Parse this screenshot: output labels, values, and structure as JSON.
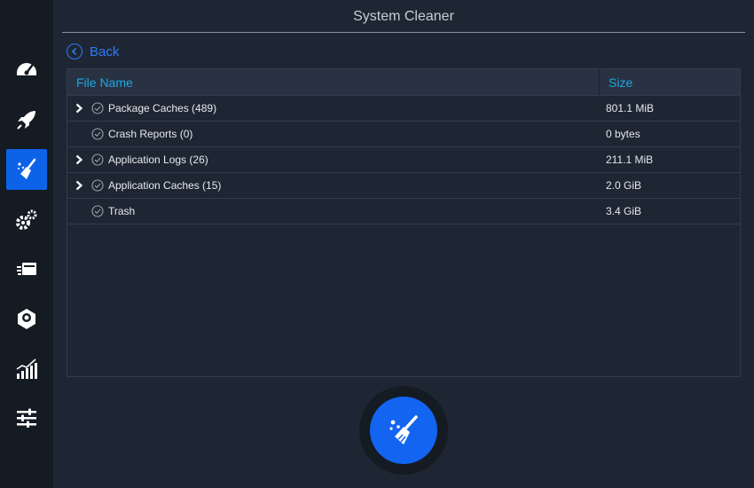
{
  "window": {
    "title": "System Cleaner"
  },
  "sidebar": {
    "items": [
      {
        "icon": "dashboard-gauge-icon"
      },
      {
        "icon": "startup-rocket-icon"
      },
      {
        "icon": "system-cleaner-broom-icon",
        "active": true
      },
      {
        "icon": "services-gears-icon"
      },
      {
        "icon": "processes-icon"
      },
      {
        "icon": "uninstaller-icon"
      },
      {
        "icon": "resources-chart-icon"
      },
      {
        "icon": "settings-sliders-icon"
      }
    ]
  },
  "back": {
    "label": "Back"
  },
  "table": {
    "columns": {
      "name": "File Name",
      "size": "Size"
    },
    "rows": [
      {
        "name": "Package Caches (489)",
        "size": "801.1 MiB",
        "expandable": true
      },
      {
        "name": "Crash Reports (0)",
        "size": "0 bytes",
        "expandable": false
      },
      {
        "name": "Application Logs (26)",
        "size": "211.1 MiB",
        "expandable": true
      },
      {
        "name": "Application Caches (15)",
        "size": "2.0 GiB",
        "expandable": true
      },
      {
        "name": "Trash",
        "size": "3.4 GiB",
        "expandable": false
      }
    ]
  },
  "clean_button": {
    "icon": "broom-clean-icon"
  },
  "colors": {
    "accent": "#1264f1",
    "header_text": "#1ea7e1",
    "background": "#1e2633",
    "sidebar": "#151b23"
  }
}
